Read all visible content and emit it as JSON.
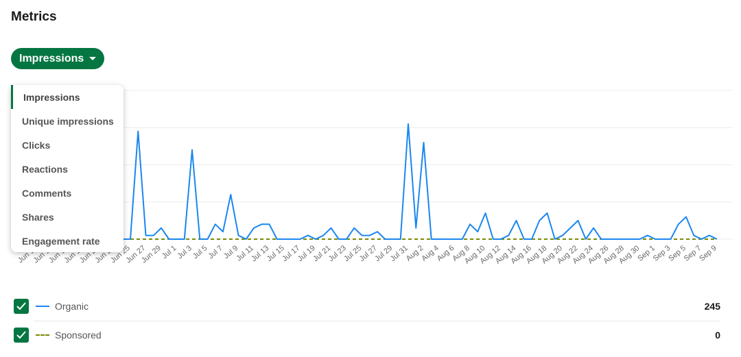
{
  "title": "Metrics",
  "metric_button": {
    "label": "Impressions",
    "icon": "caret-down-icon"
  },
  "dropdown": {
    "selected": "Impressions",
    "items": [
      "Impressions",
      "Unique impressions",
      "Clicks",
      "Reactions",
      "Comments",
      "Shares",
      "Engagement rate"
    ]
  },
  "legend": [
    {
      "name": "Organic",
      "total": "245",
      "checked": true,
      "color": "#1a86f0",
      "style": "solid"
    },
    {
      "name": "Sponsored",
      "total": "0",
      "checked": true,
      "color": "#7a8a00",
      "style": "dashed"
    }
  ],
  "colors": {
    "accent": "#057642",
    "organic": "#1a86f0",
    "sponsored": "#7a8a00"
  },
  "chart_data": {
    "type": "line",
    "x_start": "Jun 13",
    "x_end": "Sep 10",
    "tick_labels": [
      "Jun 13",
      "Jun 15",
      "Jun 17",
      "Jun 19",
      "Jun 21",
      "Jun 23",
      "Jun 25",
      "Jun 27",
      "Jun 29",
      "Jul 1",
      "Jul 3",
      "Jul 5",
      "Jul 7",
      "Jul 9",
      "Jul 11",
      "Jul 13",
      "Jul 15",
      "Jul 17",
      "Jul 19",
      "Jul 21",
      "Jul 23",
      "Jul 25",
      "Jul 27",
      "Jul 29",
      "Jul 31",
      "Aug 2",
      "Aug 4",
      "Aug 6",
      "Aug 8",
      "Aug 10",
      "Aug 12",
      "Aug 14",
      "Aug 16",
      "Aug 18",
      "Aug 20",
      "Aug 22",
      "Aug 24",
      "Aug 26",
      "Aug 28",
      "Aug 30",
      "Sep 1",
      "Sep 3",
      "Sep 5",
      "Sep 7",
      "Sep 9"
    ],
    "ylim": [
      0,
      40
    ],
    "grid": true,
    "series": [
      {
        "name": "Organic",
        "values": [
          0,
          0,
          0,
          0,
          0,
          0,
          0,
          0,
          0,
          0,
          0,
          0,
          0,
          29,
          1,
          1,
          3,
          0,
          0,
          0,
          24,
          0,
          0,
          4,
          2,
          12,
          1,
          0,
          3,
          4,
          4,
          0,
          0,
          0,
          0,
          1,
          0,
          1,
          3,
          0,
          0,
          3,
          1,
          1,
          2,
          0,
          0,
          0,
          31,
          3,
          26,
          0,
          0,
          0,
          0,
          0,
          4,
          2,
          7,
          0,
          0,
          1,
          5,
          0,
          0,
          5,
          7,
          0,
          1,
          3,
          5,
          0,
          3,
          0,
          0,
          0,
          0,
          0,
          0,
          1,
          0,
          0,
          0,
          4,
          6,
          1,
          0,
          1,
          0
        ]
      },
      {
        "name": "Sponsored",
        "values": [
          0,
          0,
          0,
          0,
          0,
          0,
          0,
          0,
          0,
          0,
          0,
          0,
          0,
          0,
          0,
          0,
          0,
          0,
          0,
          0,
          0,
          0,
          0,
          0,
          0,
          0,
          0,
          0,
          0,
          0,
          0,
          0,
          0,
          0,
          0,
          0,
          0,
          0,
          0,
          0,
          0,
          0,
          0,
          0,
          0,
          0,
          0,
          0,
          0,
          0,
          0,
          0,
          0,
          0,
          0,
          0,
          0,
          0,
          0,
          0,
          0,
          0,
          0,
          0,
          0,
          0,
          0,
          0,
          0,
          0,
          0,
          0,
          0,
          0,
          0,
          0,
          0,
          0,
          0,
          0,
          0,
          0,
          0,
          0,
          0,
          0,
          0,
          0,
          0
        ]
      }
    ]
  }
}
